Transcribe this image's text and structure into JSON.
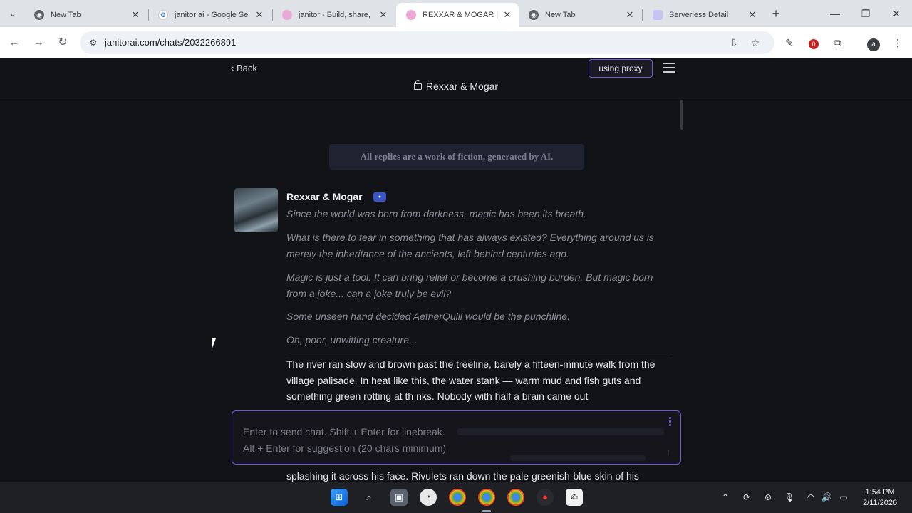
{
  "browser": {
    "tabs": [
      {
        "title": "New Tab",
        "favicon": "chrome-icon",
        "active": false
      },
      {
        "title": "janitor ai - Google Se",
        "favicon": "google-icon",
        "active": false
      },
      {
        "title": "janitor - Build, share,",
        "favicon": "janitor-icon",
        "active": false
      },
      {
        "title": "REXXAR & MOGAR |",
        "favicon": "janitor-icon",
        "active": true
      },
      {
        "title": "New Tab",
        "favicon": "chrome-icon",
        "active": false
      },
      {
        "title": "Serverless Detail",
        "favicon": "serverless-icon",
        "active": false
      }
    ],
    "url": "janitorai.com/chats/2032266891"
  },
  "header": {
    "back_label": "Back",
    "proxy_label": "using proxy",
    "chat_title": "Rexxar & Mogar"
  },
  "disclaimer": "All replies are a work of fiction, generated by AI.",
  "message": {
    "sender": "Rexxar & Mogar",
    "italic_lines": [
      "Since the world was born from darkness, magic has been its breath.",
      "What is there to fear in something that has always existed? Everything around us is merely the inheritance of the ancients, left behind centuries ago.",
      "Magic is just a tool. It can bring relief or become a crushing burden. But magic born from a joke... can a joke truly be evil?",
      "Some unseen hand decided AetherQuill would be the punchline.",
      "Oh, poor, unwitting creature..."
    ],
    "body": "The river ran slow and brown past the treeline, barely a fifteen-minute walk from the village palisade. In heat like this, the water stank — warm mud and fish guts and something green rotting at th     nks. Nobody with half a brain came out",
    "body_tail": "splashing it across his face. Rivulets ran down the pale greenish-blue skin of his"
  },
  "composer": {
    "line1": "Enter to send chat. Shift + Enter for linebreak.",
    "line2": "Alt + Enter for suggestion (20 chars minimum)"
  },
  "taskbar": {
    "time": "1:54 PM",
    "date": "2/11/2026"
  }
}
